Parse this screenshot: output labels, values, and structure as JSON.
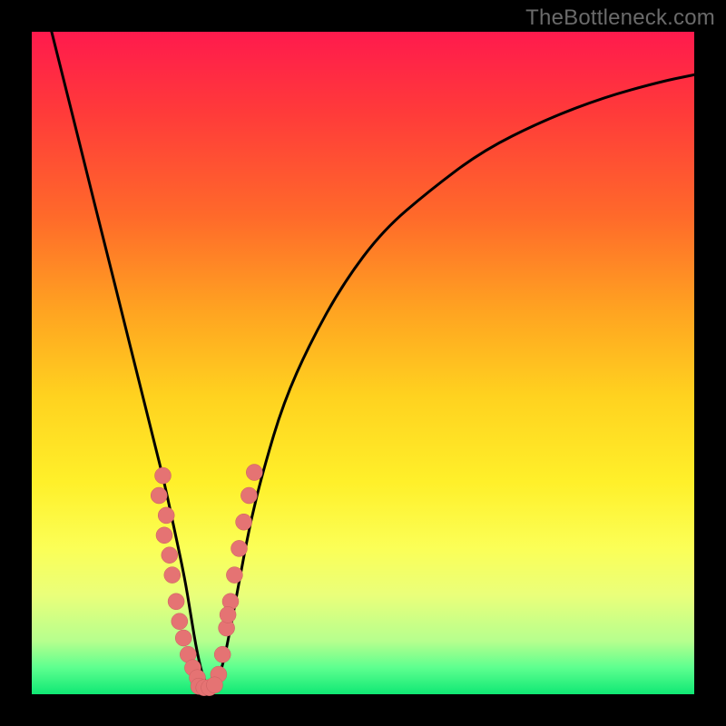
{
  "watermark": "TheBottleneck.com",
  "colors": {
    "curve_stroke": "#000000",
    "marker_fill": "#e57373",
    "marker_stroke": "#c95f5f",
    "frame_bg_top": "#ff1a4d",
    "frame_bg_bottom": "#10e874",
    "page_bg": "#000000"
  },
  "chart_data": {
    "type": "line",
    "title": "",
    "xlabel": "",
    "ylabel": "",
    "xlim": [
      0,
      100
    ],
    "ylim": [
      0,
      100
    ],
    "grid": false,
    "legend": null,
    "note": "Axes unlabeled; values are normalized 0–100 estimated from plot geometry. Curve is a V-shaped bottleneck curve with trough near x≈26.",
    "series": [
      {
        "name": "curve",
        "x": [
          3,
          5,
          8,
          11,
          14,
          16,
          18,
          20,
          21.5,
          23,
          24,
          25,
          26,
          27,
          28,
          29,
          30,
          31.5,
          33,
          35,
          38,
          42,
          47,
          53,
          60,
          68,
          77,
          86,
          95,
          100
        ],
        "y": [
          100,
          92,
          80,
          68,
          56,
          48,
          40,
          32,
          25,
          18,
          12,
          6,
          2,
          1,
          2,
          5,
          10,
          18,
          26,
          34,
          44,
          53,
          62,
          70,
          76,
          82,
          86.5,
          90,
          92.5,
          93.5
        ]
      }
    ],
    "markers_left": {
      "name": "left-cluster",
      "x": [
        19.8,
        19.2,
        20.3,
        20.0,
        20.8,
        21.2,
        21.8,
        22.3,
        22.9,
        23.6,
        24.3,
        25.0
      ],
      "y": [
        33.0,
        30.0,
        27.0,
        24.0,
        21.0,
        18.0,
        14.0,
        11.0,
        8.5,
        6.0,
        4.0,
        2.5
      ]
    },
    "markers_right": {
      "name": "right-cluster",
      "x": [
        28.2,
        28.8,
        29.4,
        30.0,
        30.6,
        31.3,
        29.6,
        32.0,
        32.8,
        33.6
      ],
      "y": [
        3.0,
        6.0,
        10.0,
        14.0,
        18.0,
        22.0,
        12.0,
        26.0,
        30.0,
        33.5
      ]
    },
    "markers_bottom": {
      "name": "trough-cluster",
      "x": [
        25.2,
        26.0,
        26.8,
        27.6
      ],
      "y": [
        1.2,
        1.0,
        1.0,
        1.4
      ]
    }
  }
}
